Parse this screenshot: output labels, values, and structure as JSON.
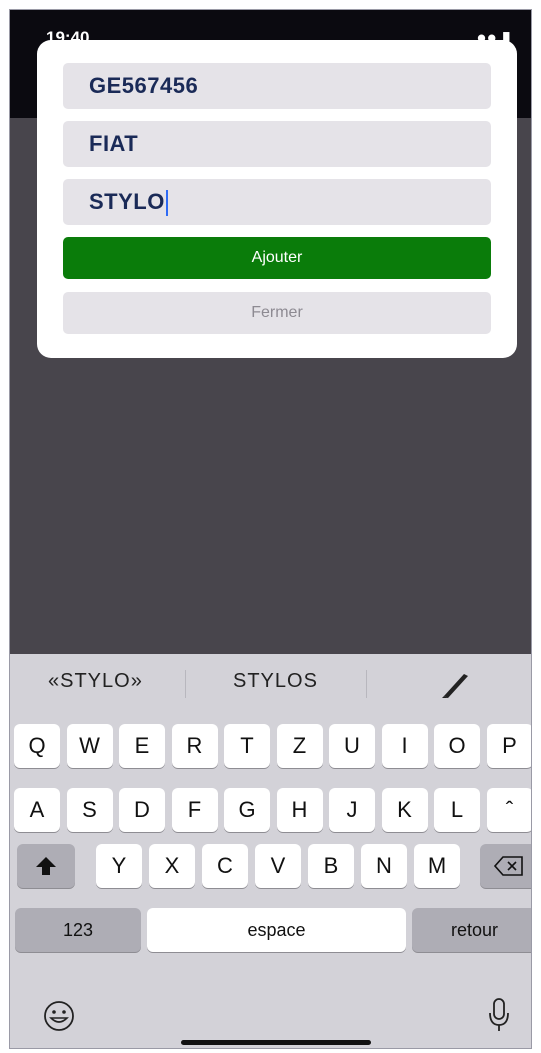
{
  "status": {
    "time": "19:40",
    "icons": "●● ▮"
  },
  "form": {
    "field1_value": "GE567456",
    "field2_value": "FIAT",
    "field3_value": "STYLO",
    "add_label": "Ajouter",
    "close_label": "Fermer"
  },
  "keyboard": {
    "suggestions": [
      "«STYLO»",
      "STYLOS"
    ],
    "row1": [
      "Q",
      "W",
      "E",
      "R",
      "T",
      "Z",
      "U",
      "I",
      "O",
      "P"
    ],
    "row2": [
      "A",
      "S",
      "D",
      "F",
      "G",
      "H",
      "J",
      "K",
      "L",
      "ˆ"
    ],
    "row3": [
      "Y",
      "X",
      "C",
      "V",
      "B",
      "N",
      "M"
    ],
    "numbers_label": "123",
    "space_label": "espace",
    "return_label": "retour"
  },
  "colors": {
    "accent": "#0a7c0a",
    "field_text": "#1a2a57",
    "caret": "#2f6bf5"
  }
}
